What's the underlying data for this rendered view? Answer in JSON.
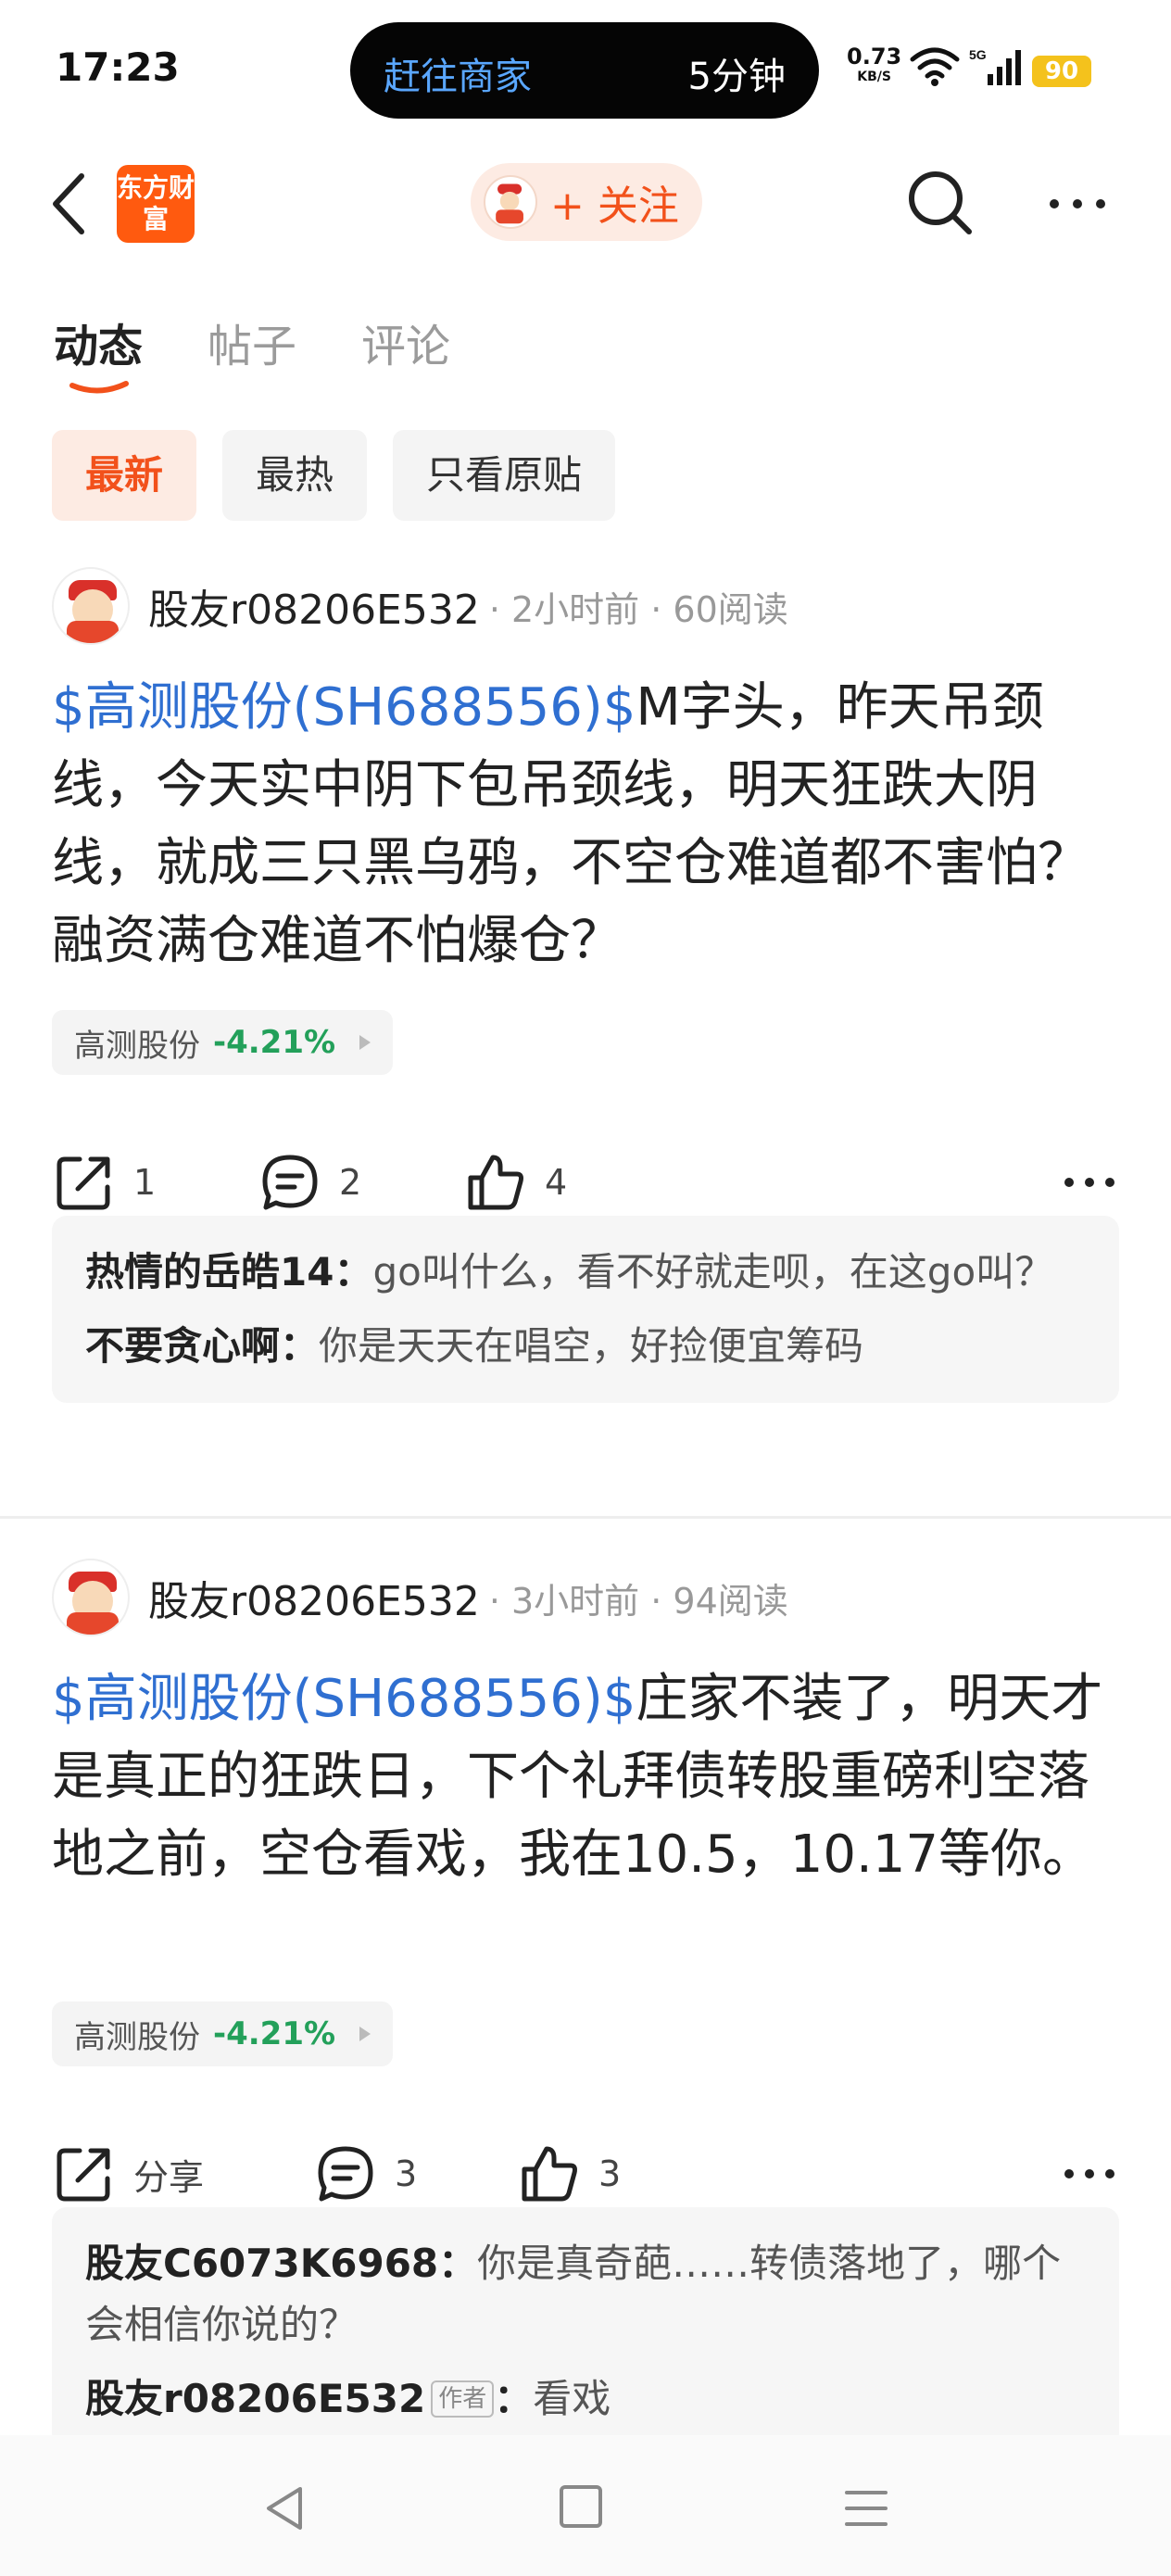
{
  "status_bar": {
    "time": "17:23",
    "island_left": "赶往商家",
    "island_right": "5分钟",
    "speed_value": "0.73",
    "speed_unit": "KB/S",
    "battery": "90"
  },
  "header": {
    "brand_logo": "东方财富",
    "follow_label": "+ 关注"
  },
  "tabs": [
    {
      "label": "动态"
    },
    {
      "label": "帖子"
    },
    {
      "label": "评论"
    }
  ],
  "filters": [
    {
      "label": "最新"
    },
    {
      "label": "最热"
    },
    {
      "label": "只看原贴"
    }
  ],
  "posts": [
    {
      "username": "股友r08206E532",
      "meta": "· 2小时前 · 60阅读",
      "stock_link": "$高测股份(SH688556)$",
      "text": "M字头，昨天吊颈线，今天实中阴下包吊颈线，明天狂跌大阴线，就成三只黑乌鸦，不空仓难道都不害怕？融资满仓难道不怕爆仓？",
      "stock_tag": {
        "name": "高测股份",
        "change": "-4.21%"
      },
      "share_count": "1",
      "comment_count": "2",
      "like_count": "4",
      "comments": [
        {
          "author": "热情的岳皓14：",
          "text": "go叫什么，看不好就走呗，在这go叫？"
        },
        {
          "author": "不要贪心啊：",
          "text": "你是天天在唱空，好捡便宜筹码"
        }
      ]
    },
    {
      "username": "股友r08206E532",
      "meta": "· 3小时前 · 94阅读",
      "stock_link": "$高测股份(SH688556)$",
      "text": "庄家不装了，明天才是真正的狂跌日，下个礼拜债转股重磅利空落地之前，空仓看戏，我在10.5，10.17等你。",
      "stock_tag": {
        "name": "高测股份",
        "change": "-4.21%"
      },
      "share_label": "分享",
      "comment_count": "3",
      "like_count": "3",
      "comments": [
        {
          "author": "股友C6073K6968：",
          "text": "你是真奇葩……转债落地了，哪个会相信你说的？"
        },
        {
          "author": "股友r08206E532",
          "badge": "作者",
          "sep": "：",
          "text": "看戏"
        }
      ]
    }
  ],
  "colors": {
    "accent": "#f2511b",
    "link": "#2f6fd1",
    "down": "#23a05a"
  }
}
